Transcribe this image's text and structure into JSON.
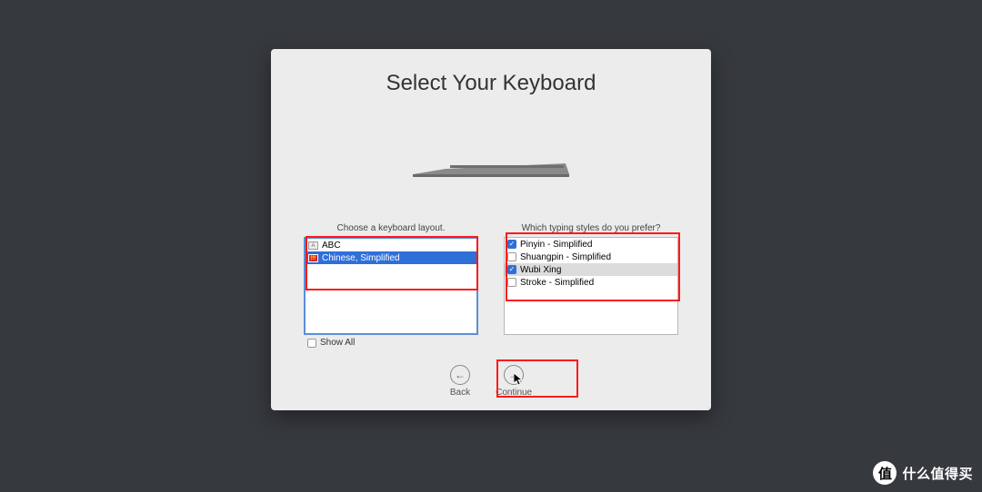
{
  "title": "Select Your Keyboard",
  "left": {
    "label": "Choose a keyboard layout.",
    "items": [
      {
        "label": "ABC",
        "flag": "A",
        "selected": false
      },
      {
        "label": "Chinese, Simplified",
        "flag": "拼",
        "selected": true
      }
    ]
  },
  "right": {
    "label": "Which typing styles do you prefer?",
    "items": [
      {
        "label": "Pinyin - Simplified",
        "checked": true,
        "highlight": false
      },
      {
        "label": "Shuangpin - Simplified",
        "checked": false,
        "highlight": false
      },
      {
        "label": "Wubi Xing",
        "checked": true,
        "highlight": true
      },
      {
        "label": "Stroke - Simplified",
        "checked": false,
        "highlight": false
      }
    ]
  },
  "showAllLabel": "Show All",
  "showAllChecked": false,
  "nav": {
    "back": "Back",
    "continue": "Continue"
  },
  "watermark": {
    "badge": "值",
    "text": "什么值得买"
  }
}
